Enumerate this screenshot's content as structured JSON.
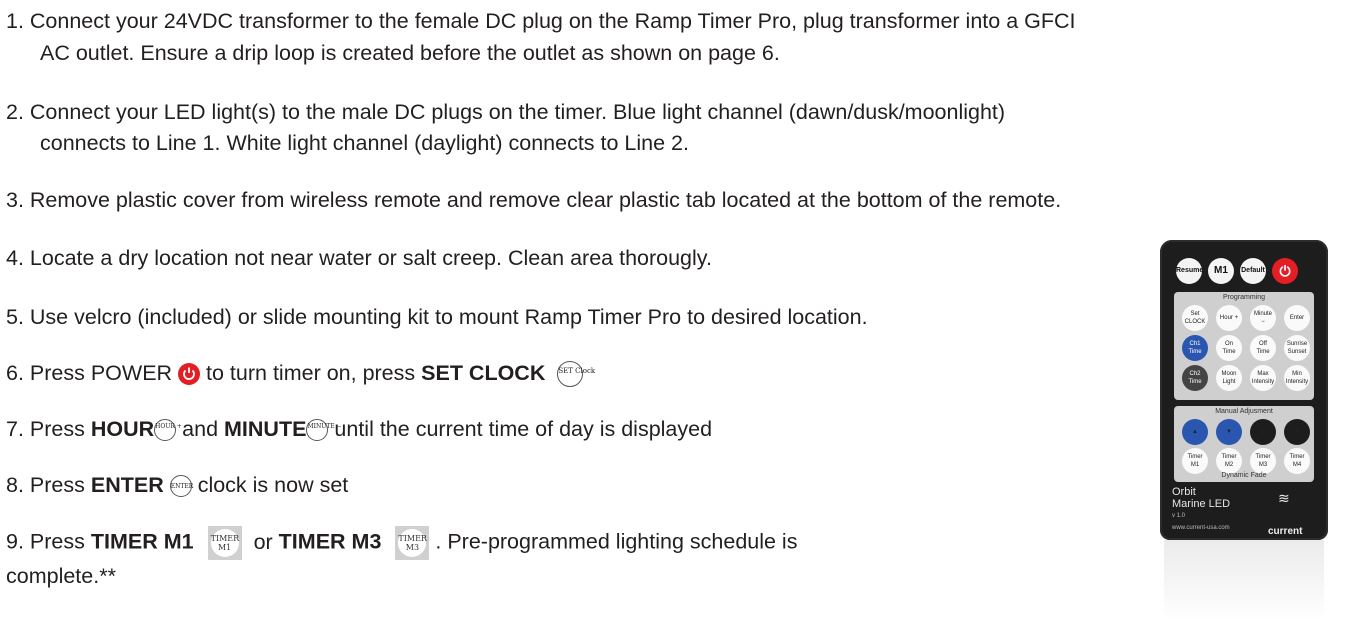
{
  "steps": {
    "s1_line1": "1. Connect your 24VDC transformer to the female DC plug on the Ramp Timer Pro, plug transformer into a GFCI",
    "s1_line2": "AC outlet.  Ensure a drip loop is created before the outlet as shown on page 6.",
    "s2_line1": "2. Connect your LED light(s) to the male DC plugs on the timer.  Blue light channel (dawn/dusk/moonlight)",
    "s2_line2": "connects to Line 1.  White light channel (daylight) connects to Line 2.",
    "s3": "3. Remove plastic cover from wireless remote and remove clear plastic tab located at the bottom of the remote.",
    "s4": "4. Locate a dry location not near water or salt creep. Clean area thorougly.",
    "s5": "5. Use velcro (included) or slide mounting kit to mount Ramp Timer Pro to desired location.",
    "s6_pre": "6. Press POWER",
    "s6_mid": "to turn timer on, press",
    "s6_bold": "SET CLOCK",
    "s7_pre": "7. Press",
    "s7_bold1": "HOUR",
    "s7_mid": "and",
    "s7_bold2": "MINUTE",
    "s7_post": "until the current time of day is displayed",
    "s8_pre": "8. Press",
    "s8_bold": "ENTER",
    "s8_post": "clock is now set",
    "s9_pre": "9. Press",
    "s9_bold1": "TIMER M1",
    "s9_mid": "or",
    "s9_bold2": "TIMER M3",
    "s9_post": ". Pre-programmed lighting schedule is",
    "s9_line2": "complete.**"
  },
  "icons": {
    "set_clock": "SET Clock",
    "hour": "HOUR +",
    "minute": "MINUTE −",
    "enter": "ENTER",
    "timer_m1_l1": "TIMER",
    "timer_m1_l2": "M1",
    "timer_m3_l1": "TIMER",
    "timer_m3_l2": "M3"
  },
  "remote": {
    "top_buttons": [
      "Resume",
      "M1",
      "Default",
      "⏻"
    ],
    "programming_title": "Programming",
    "programming_buttons": [
      "Set CLOCK",
      "Hour +",
      "Minute −",
      "Enter",
      "Ch1 Time",
      "On Time",
      "Off Time",
      "Sunrise Sunset",
      "Ch2 Time",
      "Moon Light",
      "Max Intensity",
      "Min Intensity"
    ],
    "manual_title": "Manual Adjusment",
    "timer_buttons": [
      "Timer M1",
      "Timer M2",
      "Timer M3",
      "Timer M4"
    ],
    "dynamic_title": "Dynamic Fade",
    "brand_line1": "Orbit",
    "brand_line2": "Marine LED",
    "version": "v 1.0",
    "website": "www.current-usa.com",
    "logo": "current"
  },
  "colors": {
    "power_red": "#e31e24",
    "remote_blue": "#2b56b0",
    "remote_body": "#1d1d1d"
  }
}
